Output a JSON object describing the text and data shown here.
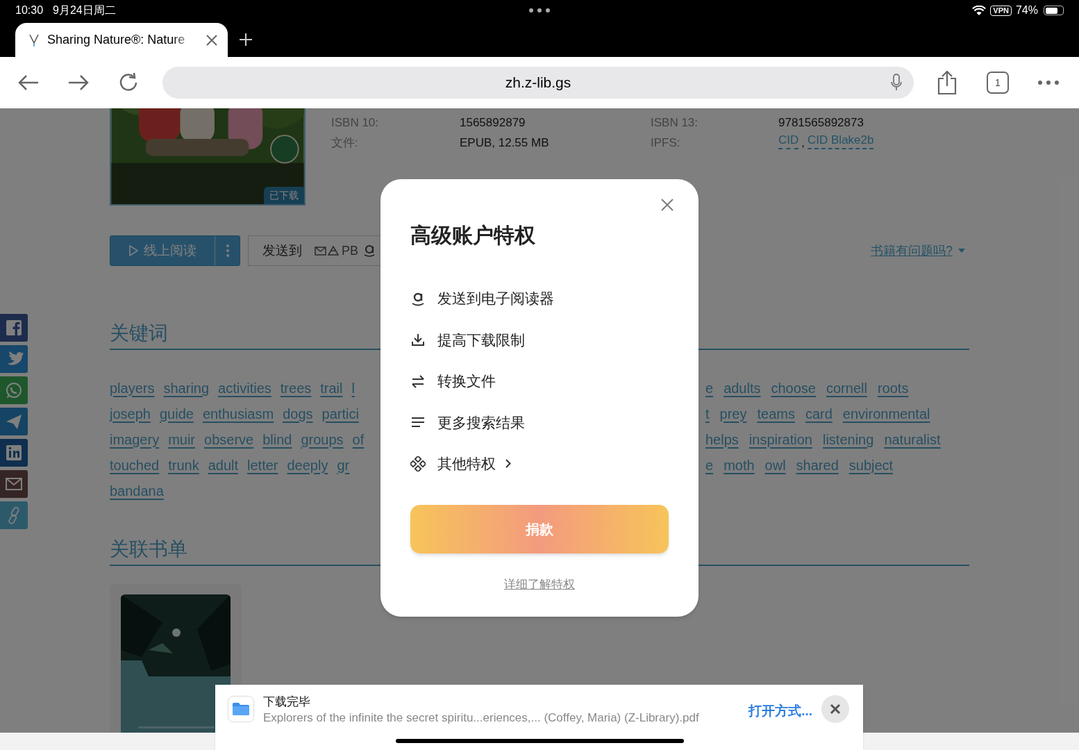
{
  "status_bar": {
    "time": "10:30",
    "date": "9月24日周二",
    "vpn": "VPN",
    "battery": "74%"
  },
  "tabs": [
    {
      "title": "Sharing Nature®: Nature",
      "selected": true
    }
  ],
  "toolbar": {
    "url": "zh.z-lib.gs",
    "tab_count": "1"
  },
  "book": {
    "cover_badge": "已下载",
    "details": [
      {
        "label": "ISBN 10:",
        "value": "1565892879"
      },
      {
        "label": "ISBN 13:",
        "value": "9781565892873"
      },
      {
        "label": "文件:",
        "value": "EPUB, 12.55 MB"
      },
      {
        "label": "IPFS:",
        "links": [
          "CID",
          "CID Blake2b"
        ],
        "separator": ","
      }
    ],
    "read_button": "线上阅读",
    "send_label": "发送到",
    "send_targets": [
      {
        "kind": "mail"
      },
      {
        "kind": "drive"
      },
      {
        "kind": "text",
        "label": "PB"
      },
      {
        "kind": "amazon"
      }
    ],
    "report_link": "书籍有问题吗?"
  },
  "keywords": {
    "title": "关键词",
    "rows": [
      {
        "left": [
          "players",
          "sharing",
          "activities",
          "trees",
          "trail",
          "l"
        ],
        "right": [
          "e",
          "adults",
          "choose",
          "cornell",
          "roots"
        ]
      },
      {
        "left": [
          "joseph",
          "guide",
          "enthusiasm",
          "dogs",
          "partici"
        ],
        "right": [
          "t",
          "prey",
          "teams",
          "card",
          "environmental"
        ]
      },
      {
        "left": [
          "imagery",
          "muir",
          "observe",
          "blind",
          "groups",
          "of"
        ],
        "right": [
          "helps",
          "inspiration",
          "listening",
          "naturalist"
        ]
      },
      {
        "left": [
          "touched",
          "trunk",
          "adult",
          "letter",
          "deeply",
          "gr"
        ],
        "right": [
          "e",
          "moth",
          "owl",
          "shared",
          "subject"
        ]
      },
      {
        "left": [
          "bandana"
        ],
        "right": []
      }
    ]
  },
  "booklists": {
    "title": "关联书单"
  },
  "share_bar": [
    {
      "kind": "facebook"
    },
    {
      "kind": "twitter"
    },
    {
      "kind": "whatsapp"
    },
    {
      "kind": "telegram"
    },
    {
      "kind": "linkedin"
    },
    {
      "kind": "email"
    },
    {
      "kind": "link"
    }
  ],
  "modal": {
    "title": "高级账户特权",
    "features": [
      {
        "kind": "amazon",
        "label": "发送到电子阅读器"
      },
      {
        "kind": "download",
        "label": "提高下载限制"
      },
      {
        "kind": "convert",
        "label": "转换文件"
      },
      {
        "kind": "list",
        "label": "更多搜索结果"
      },
      {
        "kind": "more",
        "label": "其他特权"
      }
    ],
    "donate": "捐款",
    "learn_more": "详细了解特权"
  },
  "download_banner": {
    "title": "下载完毕",
    "file": "Explorers of the infinite the secret spiritu...eriences,... (Coffey, Maria) (Z-Library).pdf",
    "action": "打开方式..."
  }
}
